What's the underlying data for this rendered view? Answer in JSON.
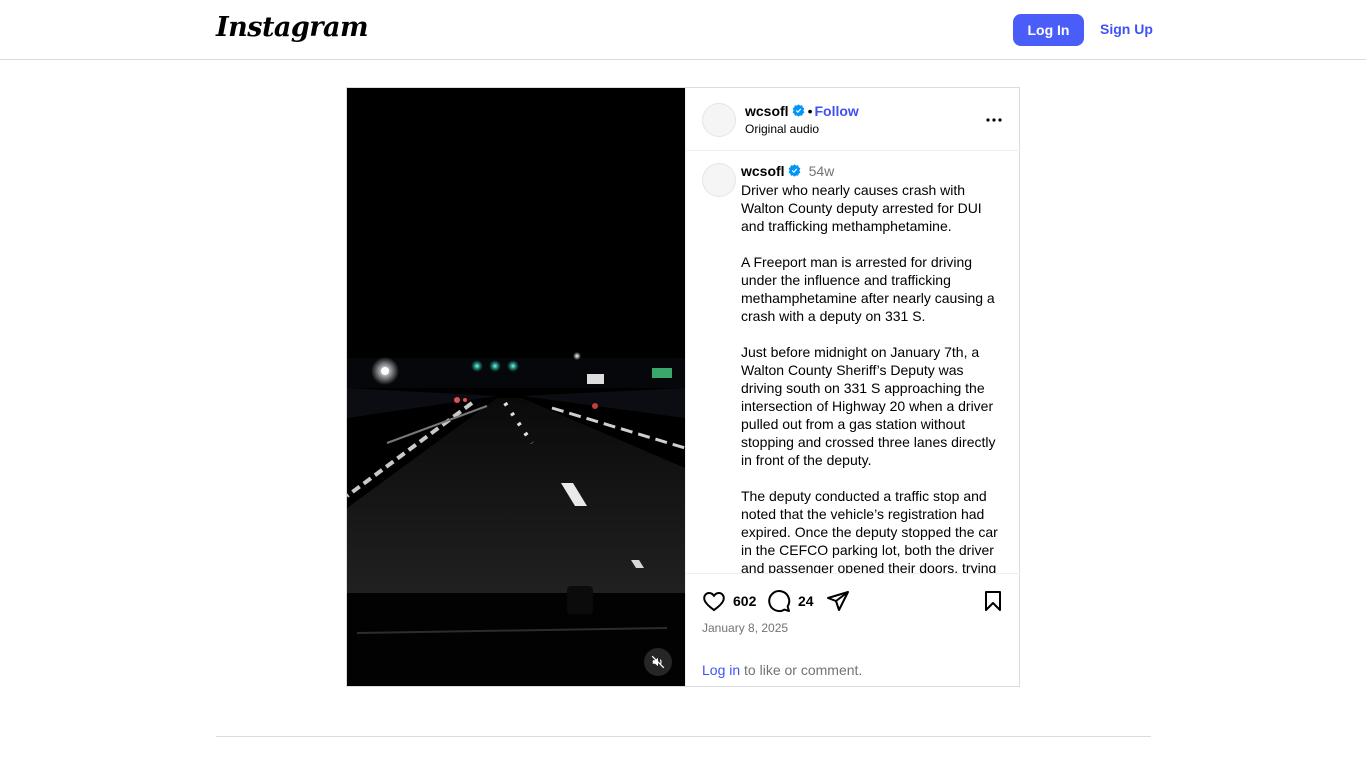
{
  "header": {
    "logo": "Instagram",
    "login_label": "Log In",
    "signup_label": "Sign Up"
  },
  "post": {
    "username": "wcsofl",
    "follow_label": "Follow",
    "separator": "•",
    "audio": "Original audio",
    "caption_username": "wcsofl",
    "time_ago": "54w",
    "caption": "Driver who nearly causes crash with Walton County deputy arrested for DUI and trafficking methamphetamine.\n\nA Freeport man is arrested for driving under the influence and trafficking methamphetamine after nearly causing a crash with a deputy on 331 S.\n\nJust before midnight on January 7th, a Walton County Sheriff’s Deputy was driving south on 331 S approaching the intersection of Highway 20 when a driver pulled out from a gas station without stopping and crossed three lanes directly in front of the deputy.\n\nThe deputy conducted a traffic stop and noted that the vehicle’s registration had expired. Once the deputy stopped the car in the CEFCO parking lot, both the driver and passenger opened their doors, trying",
    "likes": "602",
    "comments": "24",
    "date": "January 8, 2025",
    "login_link": "Log in",
    "login_suffix": " to like or comment."
  },
  "colors": {
    "accent": "#4a5df9",
    "link": "#4150f7",
    "verified": "#0095f6",
    "muted": "#737373",
    "border": "#dbdbdb"
  },
  "icons": {
    "mute": "speaker-muted-icon",
    "like": "heart-icon",
    "comment": "comment-icon",
    "share": "send-icon",
    "save": "bookmark-icon",
    "more": "more-horizontal-icon",
    "verified": "verified-badge-icon"
  }
}
